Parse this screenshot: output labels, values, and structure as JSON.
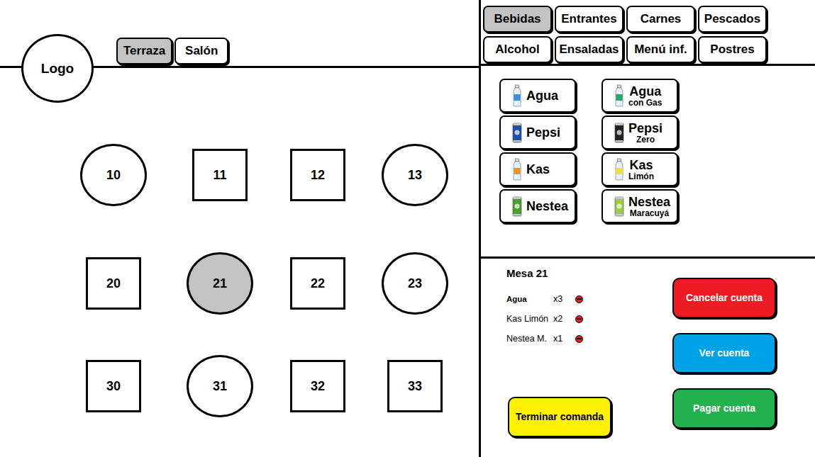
{
  "logo": "Logo",
  "zones": [
    {
      "label": "Terraza",
      "selected": true
    },
    {
      "label": "Salón",
      "selected": false
    }
  ],
  "tables": [
    {
      "number": "10",
      "kind": "round",
      "selected": false
    },
    {
      "number": "11",
      "kind": "square",
      "selected": false
    },
    {
      "number": "12",
      "kind": "square",
      "selected": false
    },
    {
      "number": "13",
      "kind": "round",
      "selected": false
    },
    {
      "number": "20",
      "kind": "square",
      "selected": false
    },
    {
      "number": "21",
      "kind": "round",
      "selected": true
    },
    {
      "number": "22",
      "kind": "square",
      "selected": false
    },
    {
      "number": "23",
      "kind": "round",
      "selected": false
    },
    {
      "number": "30",
      "kind": "square",
      "selected": false
    },
    {
      "number": "31",
      "kind": "round",
      "selected": false
    },
    {
      "number": "32",
      "kind": "square",
      "selected": false
    },
    {
      "number": "33",
      "kind": "square",
      "selected": false
    }
  ],
  "categories": [
    {
      "label": "Bebidas",
      "selected": true
    },
    {
      "label": "Entrantes",
      "selected": false
    },
    {
      "label": "Carnes",
      "selected": false
    },
    {
      "label": "Pescados",
      "selected": false
    },
    {
      "label": "Alcohol",
      "selected": false
    },
    {
      "label": "Ensaladas",
      "selected": false
    },
    {
      "label": "Menú inf.",
      "selected": false
    },
    {
      "label": "Postres",
      "selected": false
    }
  ],
  "products": [
    {
      "name": "Agua",
      "subtitle": "",
      "kind": "bottle",
      "color": "#3b8fd9"
    },
    {
      "name": "Agua",
      "subtitle": "con Gas",
      "kind": "bottle",
      "color": "#2fa36b"
    },
    {
      "name": "Pepsi",
      "subtitle": "",
      "kind": "can",
      "color": "#1f4fa8"
    },
    {
      "name": "Pepsi",
      "subtitle": "Zero",
      "kind": "can",
      "color": "#222222"
    },
    {
      "name": "Kas",
      "subtitle": "",
      "kind": "bottle",
      "color": "#f7941d"
    },
    {
      "name": "Kas",
      "subtitle": "Limón",
      "kind": "bottle",
      "color": "#f2e230"
    },
    {
      "name": "Nestea",
      "subtitle": "",
      "kind": "can",
      "color": "#4aa02c"
    },
    {
      "name": "Nestea",
      "subtitle": "Maracuyá",
      "kind": "can",
      "color": "#9bcf3f"
    }
  ],
  "order": {
    "title": "Mesa 21",
    "items": [
      {
        "name": "Agua",
        "qty": "x3",
        "selected": true
      },
      {
        "name": "Kas Limón",
        "qty": "x2",
        "selected": false
      },
      {
        "name": "Nestea M.",
        "qty": "x1",
        "selected": false
      }
    ]
  },
  "actions": [
    {
      "label": "Cancelar cuenta",
      "color": "#ed1c24"
    },
    {
      "label": "Ver cuenta",
      "color": "#00a2e8"
    },
    {
      "label": "Pagar cuenta",
      "color": "#22b14c"
    }
  ],
  "finish": {
    "label": "Terminar comanda",
    "color": "#fff200"
  }
}
